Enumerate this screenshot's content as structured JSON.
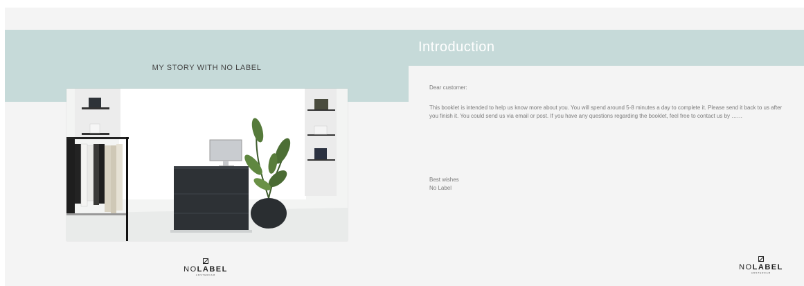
{
  "left": {
    "title": "MY STORY WITH NO LABEL",
    "logo": {
      "no": "NO",
      "label": "LABEL",
      "sub": "AMSTERDAM"
    }
  },
  "right": {
    "title": "Introduction",
    "greeting": "Dear customer:",
    "body": "This booklet is intended to help us know more about you. You will spend around 5-8 minutes a day to complete it.  Please send it back to us after you finish it. You could send us via email or post. If you have any questions regarding the booklet, feel free to contact us by ……",
    "signoff_line1": "Best wishes",
    "signoff_line2": "No Label",
    "logo": {
      "no": "NO",
      "label": "LABEL",
      "sub": "AMSTERDAM"
    }
  },
  "colors": {
    "accent": "#c6dad9",
    "page": "#f4f4f4",
    "text": "#7a7a7a"
  },
  "image": {
    "subject": "store-interior-photo"
  }
}
